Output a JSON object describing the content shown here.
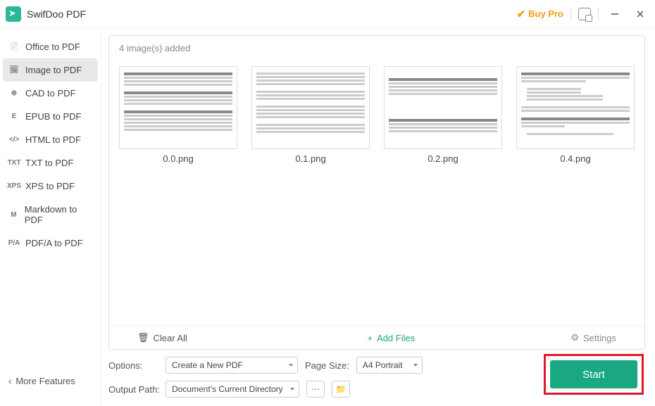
{
  "app": {
    "title": "SwifDoo PDF",
    "buy_pro": "Buy Pro"
  },
  "sidebar": {
    "items": [
      {
        "label": "Office to PDF",
        "icon": "📄"
      },
      {
        "label": "Image to PDF",
        "icon": "🖼"
      },
      {
        "label": "CAD to PDF",
        "icon": "⊕"
      },
      {
        "label": "EPUB to PDF",
        "icon": "E"
      },
      {
        "label": "HTML to PDF",
        "icon": "</>"
      },
      {
        "label": "TXT to PDF",
        "icon": "TXT"
      },
      {
        "label": "XPS to PDF",
        "icon": "XPS"
      },
      {
        "label": "Markdown to PDF",
        "icon": "M"
      },
      {
        "label": "PDF/A to PDF",
        "icon": "P/A"
      }
    ],
    "more": "More Features"
  },
  "drop": {
    "header": "4 image(s) added",
    "thumbs": [
      "0.0.png",
      "0.1.png",
      "0.2.png",
      "0.4.png"
    ],
    "clear": "Clear All",
    "add": "Add Files",
    "settings": "Settings"
  },
  "controls": {
    "options_label": "Options:",
    "options_value": "Create a New PDF",
    "page_size_label": "Page Size:",
    "page_size_value": "A4 Portrait",
    "output_label": "Output Path:",
    "output_value": "Document's Current Directory"
  },
  "start": "Start"
}
